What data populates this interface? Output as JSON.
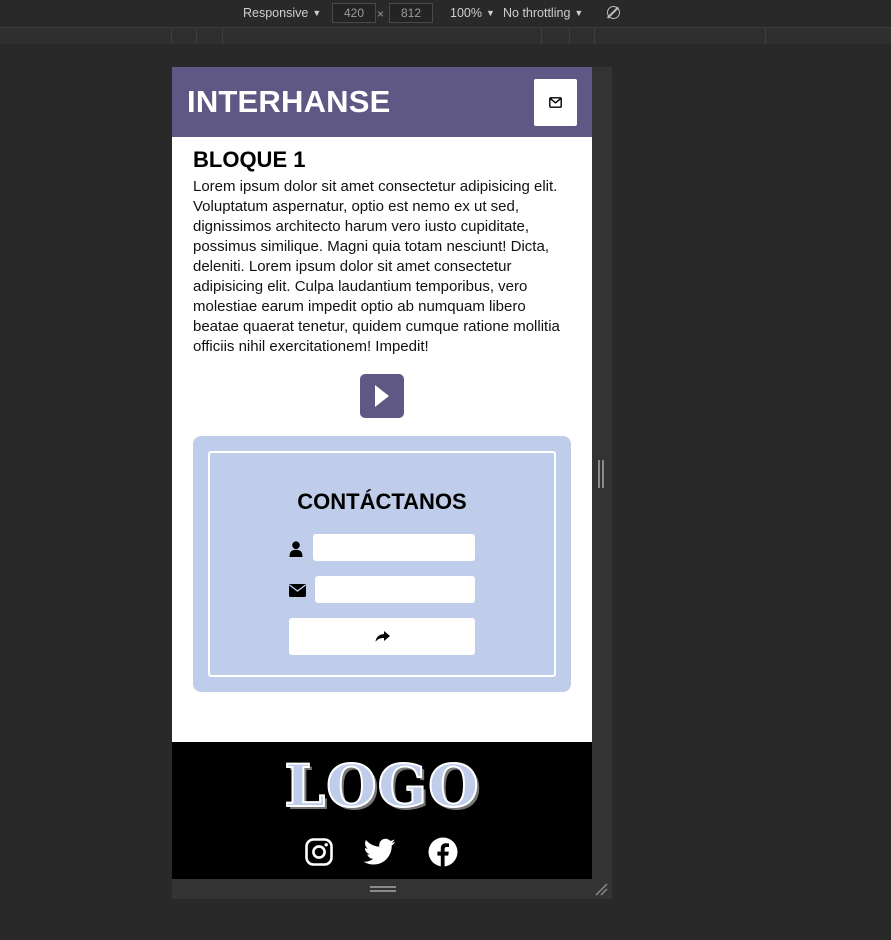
{
  "devtools": {
    "device_mode": "Responsive",
    "width": "420",
    "height": "812",
    "dim_separator": "×",
    "zoom": "100%",
    "throttling": "No throttling"
  },
  "header": {
    "brand": "INTERHANSE",
    "mail_icon": "envelope-icon"
  },
  "content": {
    "block_title": "BLOQUE 1",
    "block_text": "Lorem ipsum dolor sit amet consectetur adipisicing elit. Voluptatum aspernatur, optio est nemo ex ut sed, dignissimos architecto harum vero iusto cupiditate, possimus similique. Magni quia totam nesciunt! Dicta, deleniti. Lorem ipsum dolor sit amet consectetur adipisicing elit. Culpa laudantium temporibus, vero molestiae earum impedit optio ab numquam libero beatae quaerat tenetur, quidem cumque ratione mollitia officiis nihil exercitationem! Impedit!",
    "play_icon": "play-icon"
  },
  "contact": {
    "title": "CONTÁCTANOS",
    "name_value": "",
    "email_value": "",
    "send_icon": "share-arrow-icon"
  },
  "footer": {
    "logo": "LOGO",
    "social_icons": [
      "instagram-icon",
      "twitter-icon",
      "facebook-icon"
    ]
  },
  "colors": {
    "header_bg": "#5f5884",
    "contact_bg": "#bfcdeb",
    "footer_bg": "#000000",
    "devtools_bg": "#292929"
  }
}
